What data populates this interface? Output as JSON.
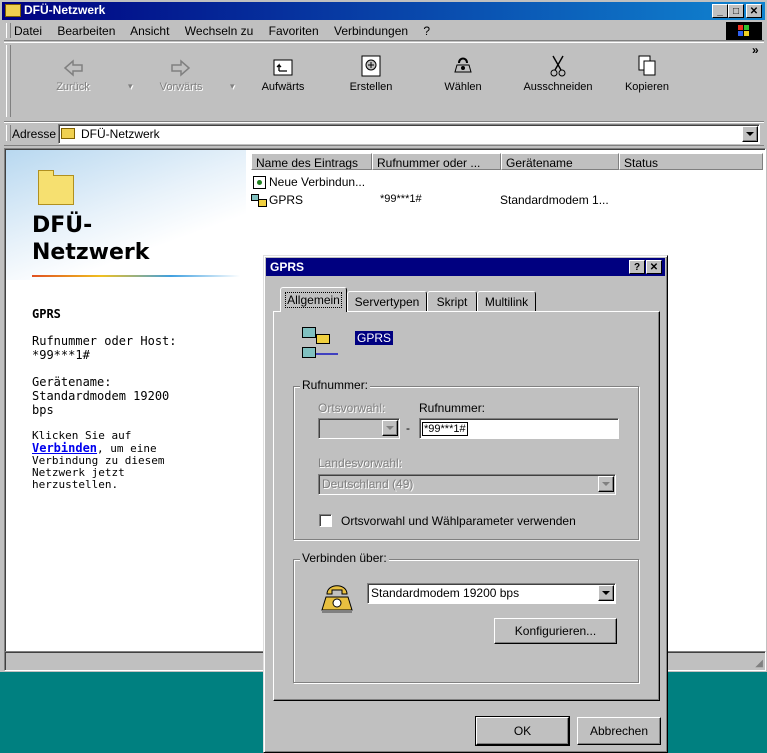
{
  "window": {
    "title": "DFÜ-Netzwerk",
    "menu": [
      "Datei",
      "Bearbeiten",
      "Ansicht",
      "Wechseln zu",
      "Favoriten",
      "Verbindungen",
      "?"
    ],
    "toolbar": {
      "back": "Zurück",
      "forward": "Vorwärts",
      "up": "Aufwärts",
      "create": "Erstellen",
      "dial": "Wählen",
      "cut": "Ausschneiden",
      "copy": "Kopieren",
      "more": "»"
    },
    "address_label": "Adresse",
    "address_value": "DFÜ-Netzwerk"
  },
  "sidebar": {
    "heading_line1": "DFÜ-",
    "heading_line2": "Netzwerk",
    "item_name": "GPRS",
    "host_label": "Rufnummer oder Host:",
    "host_value": "*99***1#",
    "device_label": "Gerätename:",
    "device_value_1": "Standardmodem 19200",
    "device_value_2": "bps",
    "hint_1": "Klicken Sie auf",
    "hint_link": "Verbinden",
    "hint_2": ", um eine",
    "hint_3": "Verbindung zu diesem",
    "hint_4": "Netzwerk jetzt",
    "hint_5": "herzustellen."
  },
  "list": {
    "columns": [
      "Name des Eintrags",
      "Rufnummer oder ...",
      "Gerätename",
      "Status"
    ],
    "rows": [
      {
        "name": "Neue Verbindun...",
        "number": "",
        "device": "",
        "status": ""
      },
      {
        "name": "GPRS",
        "number": "*99***1#",
        "device": "Standardmodem 1...",
        "status": ""
      }
    ]
  },
  "dialog": {
    "title": "GPRS",
    "tabs": [
      "Allgemein",
      "Servertypen",
      "Skript",
      "Multilink"
    ],
    "connection_name": "GPRS",
    "rufnummer_group": "Rufnummer:",
    "ortsvorwahl_label": "Ortsvorwahl:",
    "ortsvorwahl_value": "",
    "separator": "-",
    "rufnummer_label": "Rufnummer:",
    "rufnummer_value": "*99***1#",
    "landesvorwahl_label": "Landesvorwahl:",
    "landesvorwahl_value": "Deutschland (49)",
    "checkbox_label": "Ortsvorwahl und Wählparameter verwenden",
    "checkbox_checked": false,
    "connect_group": "Verbinden über:",
    "modem_value": "Standardmodem 19200 bps",
    "configure_button": "Konfigurieren...",
    "ok_button": "OK",
    "cancel_button": "Abbrechen"
  }
}
